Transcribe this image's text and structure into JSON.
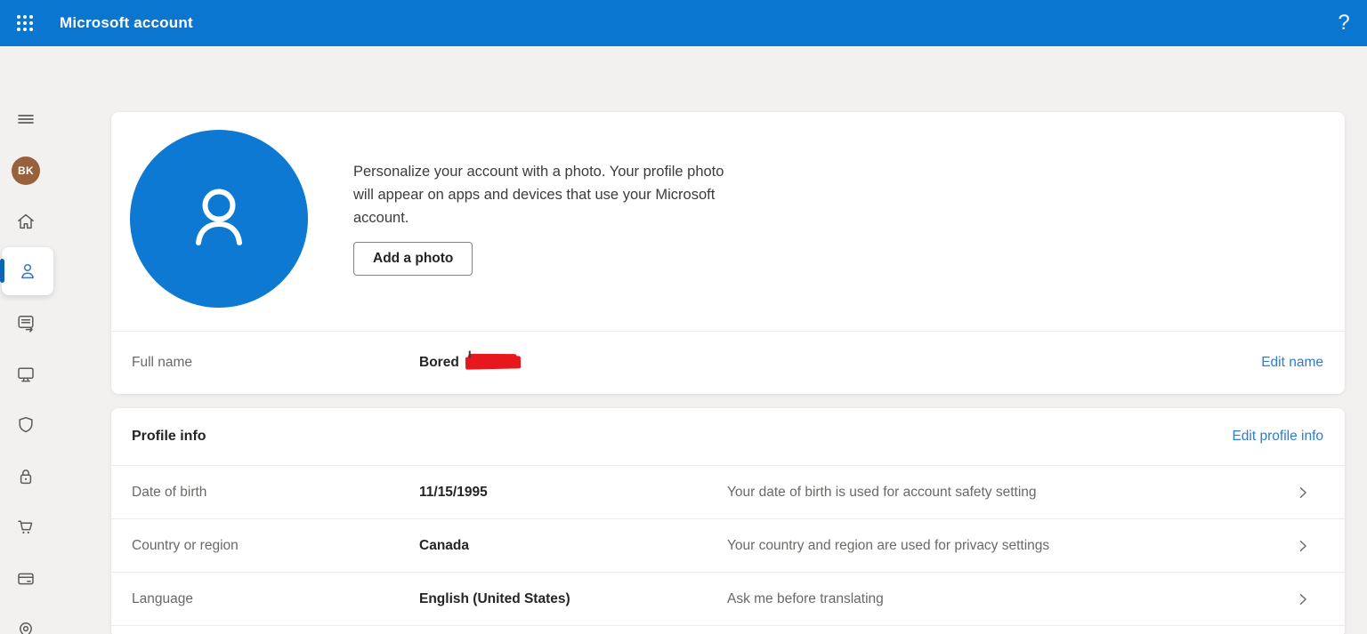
{
  "header": {
    "title": "Microsoft account",
    "app_launcher_icon": "waffle-icon",
    "help_label": "?"
  },
  "colors": {
    "header_blue": "#0b76cf",
    "avatar_placeholder_blue": "#0d79d3",
    "link_blue": "#2b7cd3",
    "avatar_brown": "#96613b",
    "selected_indicator": "#0d66b5",
    "background": "#f2f1f0"
  },
  "sidebar": {
    "avatar_initials": "BK",
    "items": [
      {
        "id": "menu",
        "icon": "hamburger-icon",
        "selected": false
      },
      {
        "id": "account-avatar",
        "icon": "avatar",
        "selected": false
      },
      {
        "id": "home",
        "icon": "home-icon",
        "selected": false
      },
      {
        "id": "your-info",
        "icon": "person-icon",
        "selected": true
      },
      {
        "id": "subscriptions",
        "icon": "news-arrow-icon",
        "selected": false
      },
      {
        "id": "devices",
        "icon": "monitor-icon",
        "selected": false
      },
      {
        "id": "security",
        "icon": "shield-icon",
        "selected": false
      },
      {
        "id": "privacy",
        "icon": "lock-icon",
        "selected": false
      },
      {
        "id": "order-history",
        "icon": "cart-icon",
        "selected": false
      },
      {
        "id": "payment-options",
        "icon": "credit-card-icon",
        "selected": false
      },
      {
        "id": "addresses",
        "icon": "location-pin-icon",
        "selected": false
      }
    ]
  },
  "photo_card": {
    "description": "Personalize your account with a photo. Your profile photo will appear on apps and devices that use your Microsoft account.",
    "add_photo_button": "Add a photo",
    "full_name_label": "Full name",
    "full_name_value": "Bored",
    "last_name_redacted": true,
    "edit_name_link": "Edit name"
  },
  "profile_info_card": {
    "title": "Profile info",
    "edit_link": "Edit profile info",
    "rows": [
      {
        "label": "Date of birth",
        "value": "11/15/1995",
        "description": "Your date of birth is used for account safety setting"
      },
      {
        "label": "Country or region",
        "value": "Canada",
        "description": "Your country and region are used for privacy settings"
      },
      {
        "label": "Language",
        "value": "English (United States)",
        "description": "Ask me before translating"
      }
    ]
  }
}
